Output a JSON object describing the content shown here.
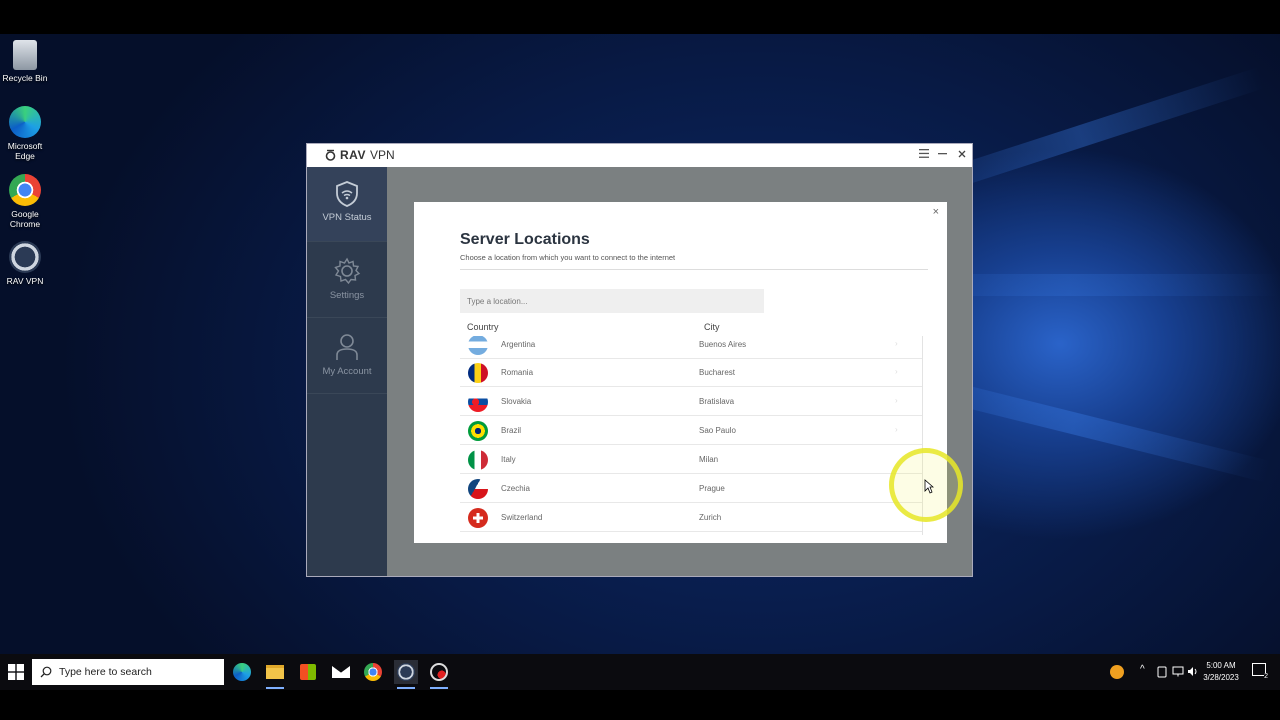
{
  "desktop": {
    "icons": [
      {
        "label": "Recycle Bin"
      },
      {
        "label": "Microsoft Edge"
      },
      {
        "label": "Google Chrome"
      },
      {
        "label": "RAV VPN"
      }
    ]
  },
  "app": {
    "brand_rav": "RAV",
    "brand_vpn": "VPN",
    "sidebar": [
      {
        "label": "VPN Status",
        "icon": "shield-wifi-icon"
      },
      {
        "label": "Settings",
        "icon": "gear-icon"
      },
      {
        "label": "My Account",
        "icon": "user-icon"
      }
    ]
  },
  "modal": {
    "title": "Server Locations",
    "subtitle": "Choose a location from which you want to connect to the internet",
    "close": "×",
    "search_placeholder": "Type a location...",
    "col_country": "Country",
    "col_city": "City",
    "rows": [
      {
        "country": "Argentina",
        "city": "Buenos Aires"
      },
      {
        "country": "Romania",
        "city": "Bucharest"
      },
      {
        "country": "Slovakia",
        "city": "Bratislava"
      },
      {
        "country": "Brazil",
        "city": "Sao Paulo"
      },
      {
        "country": "Italy",
        "city": "Milan"
      },
      {
        "country": "Czechia",
        "city": "Prague"
      },
      {
        "country": "Switzerland",
        "city": "Zurich"
      }
    ],
    "chevron": "›"
  },
  "taskbar": {
    "search_placeholder": "Type here to search",
    "time": "5:00 AM",
    "date": "3/28/2023",
    "notification_count": "2"
  },
  "colors": {
    "sidebar": "#2d3a4d",
    "accent": "#2b3440"
  }
}
